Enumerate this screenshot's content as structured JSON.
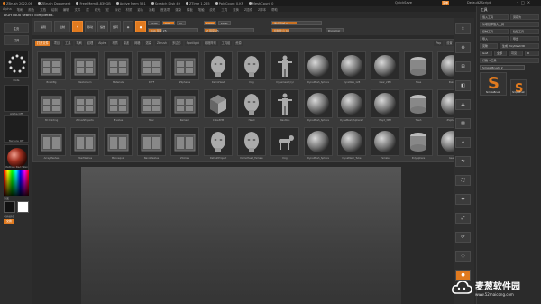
{
  "titlebar": {
    "items": [
      "ZBrush 2022.06",
      "ZBrush Document",
      "Free Mem 8.839GB",
      "Active Mem 551",
      "Scratch Disk 49",
      "ZTime 1.265",
      "PolyCount 0.KP",
      "MeshCount 0"
    ],
    "dot_colors": [
      "#e07a1f",
      "#bbbbbb",
      "#bbbbbb",
      "#bbbbbb",
      "#bbbbbb",
      "#bbbbbb",
      "#bbbbbb",
      "#bbbbbb"
    ],
    "quicksave": "QuickSave",
    "menu_label": "菜单",
    "default_script": "DefaultZScript"
  },
  "menubar": [
    "Alpha",
    "笔刷",
    "颜色",
    "文档",
    "绘制",
    "编辑",
    "文件",
    "层",
    "灯光",
    "宏",
    "标记",
    "材质",
    "影片",
    "拾取",
    "首选项",
    "渲染",
    "模板",
    "笔触",
    "纹理",
    "工具",
    "变换",
    "Z插件",
    "Z脚本",
    "帮助"
  ],
  "lightbox_message": "LIGHTBOX search completed.",
  "left_panel": {
    "home_button": "主页",
    "open_button": "打开",
    "brush_label": "Dots",
    "alpha_label": "Alpha Off",
    "texture_label": "Texture Off",
    "material_label": "MatCap Red Wax",
    "gradient_label": "渐变",
    "switch_color_label": "切换颜色",
    "swap_label": "交换"
  },
  "toolbar": {
    "edit": "编辑",
    "draw": "绘制",
    "move": "移动",
    "scale": "缩放",
    "rotate": "旋转",
    "mrgb": "Mrgb",
    "rgb": "Rgb",
    "m": "M",
    "zadd": "Zadd",
    "zsub": "Zsub",
    "rgb_intensity": "Rgb 强度 25",
    "rgb_intensity_value": 0.25,
    "z_intensity": "Z 强度 25",
    "z_intensity_value": 0.25,
    "focal_shift": "焦点衰减 0",
    "focal_shift_value": 0.5,
    "draw_size": "绘制大小 64",
    "draw_size_value": 0.35,
    "dynamic": "Dynamic"
  },
  "lightbox": {
    "tabs": [
      "打开文件",
      "项目",
      "工具",
      "笔刷",
      "纹理",
      "Alpha",
      "材质",
      "噪波",
      "网格",
      "渲染",
      "Zbrush",
      "多边形",
      "Spotlight",
      "网格阵列",
      "工具组",
      "资源"
    ],
    "active_tab": 0,
    "right_buttons": [
      "Pop",
      "设置",
      "帮助"
    ],
    "rows": [
      [
        "BrushBg",
        "MeshAlbum",
        "Materials",
        "DFFF",
        "ZSpheres",
        "DemoHead",
        "Dog",
        "Dynamesh_Cyl",
        "DynaMesh_Sphere",
        "DynaWax_128",
        "Gear_2PM",
        "Hose",
        "Paint"
      ],
      [
        "3D Printing",
        "ZBrushProjects",
        "Brushes",
        "Misc",
        "Remesh",
        "Cube3PM",
        "Head",
        "Nautilus",
        "DynaMesh_Sphere",
        "DynaMesh_Sphere2",
        "Hayd_3PM",
        "Trash",
        "ZSphere"
      ],
      [
        "ArrayMeshes",
        "FiberMeshes",
        "Mannequin",
        "NanoMeshes",
        "ZColors",
        "DefaultProject",
        "DemoHead_Female",
        "Dog",
        "DynaMesh_Sphere",
        "DynaMesh_Tube",
        "Female",
        "PolySphere",
        "Gear"
      ]
    ]
  },
  "right_tools": [
    "滚动",
    "缩放",
    "Actual",
    "AAHalf",
    "Persp",
    "Floor",
    "Local",
    "L.Sym",
    "Frame",
    "Move",
    "Zoom3D",
    "Rotate",
    "Transp",
    "Solo"
  ],
  "tool_panel": {
    "title": "工具",
    "load_tool": "载入工具",
    "save_as": "另存为",
    "load_from_project": "从项目中载入工具",
    "copy_tool": "复制工具",
    "paste_tool": "粘贴工具",
    "import": "导入",
    "export": "导出",
    "clone": "克隆",
    "make_polymesh": "生成 PolyMesh3D",
    "goz": "GoZ",
    "all": "全部",
    "visible": "可见",
    "r": "R",
    "lightbox_tools": "灯箱 >工具",
    "current_tool": "SimpleBrush. 2",
    "thumbs": [
      "SimpleBrush",
      "SimpleBrush"
    ]
  },
  "watermark": {
    "title": "麦葱软件园",
    "url": "www.52maicong.com"
  }
}
